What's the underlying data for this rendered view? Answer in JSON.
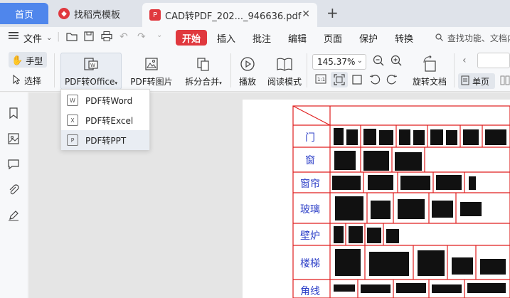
{
  "tabs": {
    "home": "首页",
    "template": "找稻壳模板",
    "active_doc": "CAD转PDF_202..._946636.pdf"
  },
  "menu": {
    "file": "文件",
    "items": [
      "开始",
      "插入",
      "批注",
      "编辑",
      "页面",
      "保护",
      "转换"
    ],
    "search": "查找功能、文档内"
  },
  "ribbon": {
    "hand": "手型",
    "select": "选择",
    "pdf_office": "PDF转Office",
    "pdf_image": "PDF转图片",
    "split_merge": "拆分合并",
    "play": "播放",
    "read_mode": "阅读模式",
    "zoom": "145.37%",
    "rotate_doc": "旋转文档",
    "single_page": "单页"
  },
  "dropdown": {
    "items": [
      "PDF转Word",
      "PDF转Excel",
      "PDF转PPT"
    ],
    "selected": "PDF转PPT"
  },
  "document": {
    "row_labels": [
      "门",
      "窗",
      "窗帘",
      "玻璃",
      "壁炉",
      "楼梯",
      "角线"
    ]
  },
  "colors": {
    "accent_red": "#e0383e",
    "home_tab": "#4f86ec",
    "table_line": "#e01f1f",
    "label_blue": "#2b3ec7"
  }
}
